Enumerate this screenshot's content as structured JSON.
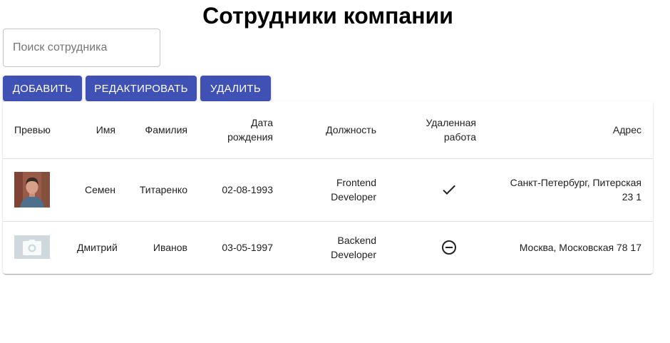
{
  "page": {
    "title": "Сотрудники компании"
  },
  "search": {
    "placeholder": "Поиск сотрудника",
    "value": ""
  },
  "toolbar": {
    "add_label": "Добавить",
    "edit_label": "Редактировать",
    "delete_label": "Удалить"
  },
  "colors": {
    "primary": "#3f51b5",
    "placeholder_bg": "#cfd8dc"
  },
  "table": {
    "headers": {
      "preview": "Превью",
      "first_name": "Имя",
      "last_name": "Фамилия",
      "birth_date": "Дата рождения",
      "position": "Должность",
      "remote": "Удаленная работа",
      "address": "Адрес"
    },
    "rows": [
      {
        "preview_icon": "employee-photo",
        "first_name": "Семен",
        "last_name": "Титаренко",
        "birth_date": "02-08-1993",
        "position": "Frontend Developer",
        "remote_icon": "check-icon",
        "address": "Санкт-Петербург, Питерская 23 1"
      },
      {
        "preview_icon": "camera-icon",
        "first_name": "Дмитрий",
        "last_name": "Иванов",
        "birth_date": "03-05-1997",
        "position": "Backend Developer",
        "remote_icon": "minus-circle-icon",
        "address": "Москва, Московская 78 17"
      }
    ]
  }
}
